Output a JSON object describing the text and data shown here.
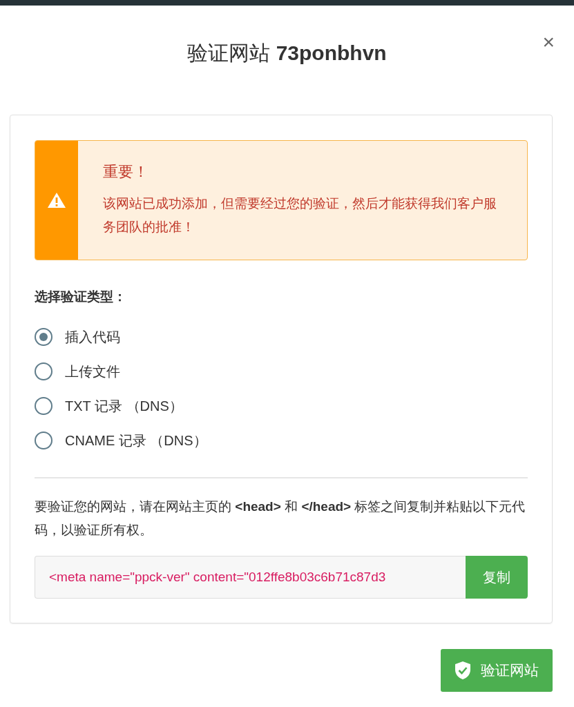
{
  "dialog": {
    "title": "验证网站 **73ponbhvn**",
    "close": "×"
  },
  "alert": {
    "heading": "重要！",
    "message": "该网站已成功添加，但需要经过您的验证，然后才能获得我们客户服务团队的批准！"
  },
  "verification_type": {
    "label": "选择验证类型：",
    "options": [
      {
        "label": "插入代码",
        "selected": true
      },
      {
        "label": "上传文件",
        "selected": false
      },
      {
        "label": "TXT 记录 （DNS）",
        "selected": false
      },
      {
        "label": "CNAME 记录 （DNS）",
        "selected": false
      }
    ]
  },
  "instructions": "要验证您的网站，请在网站主页的 **<head>** 和 **</head>** 标签之间复制并粘贴以下元代码，以验证所有权。",
  "code_field": {
    "value": "<meta name=\"ppck-ver\" content=\"012ffe8b03c6b71c87d3",
    "button": "复制"
  },
  "verify_button": "验证网站"
}
